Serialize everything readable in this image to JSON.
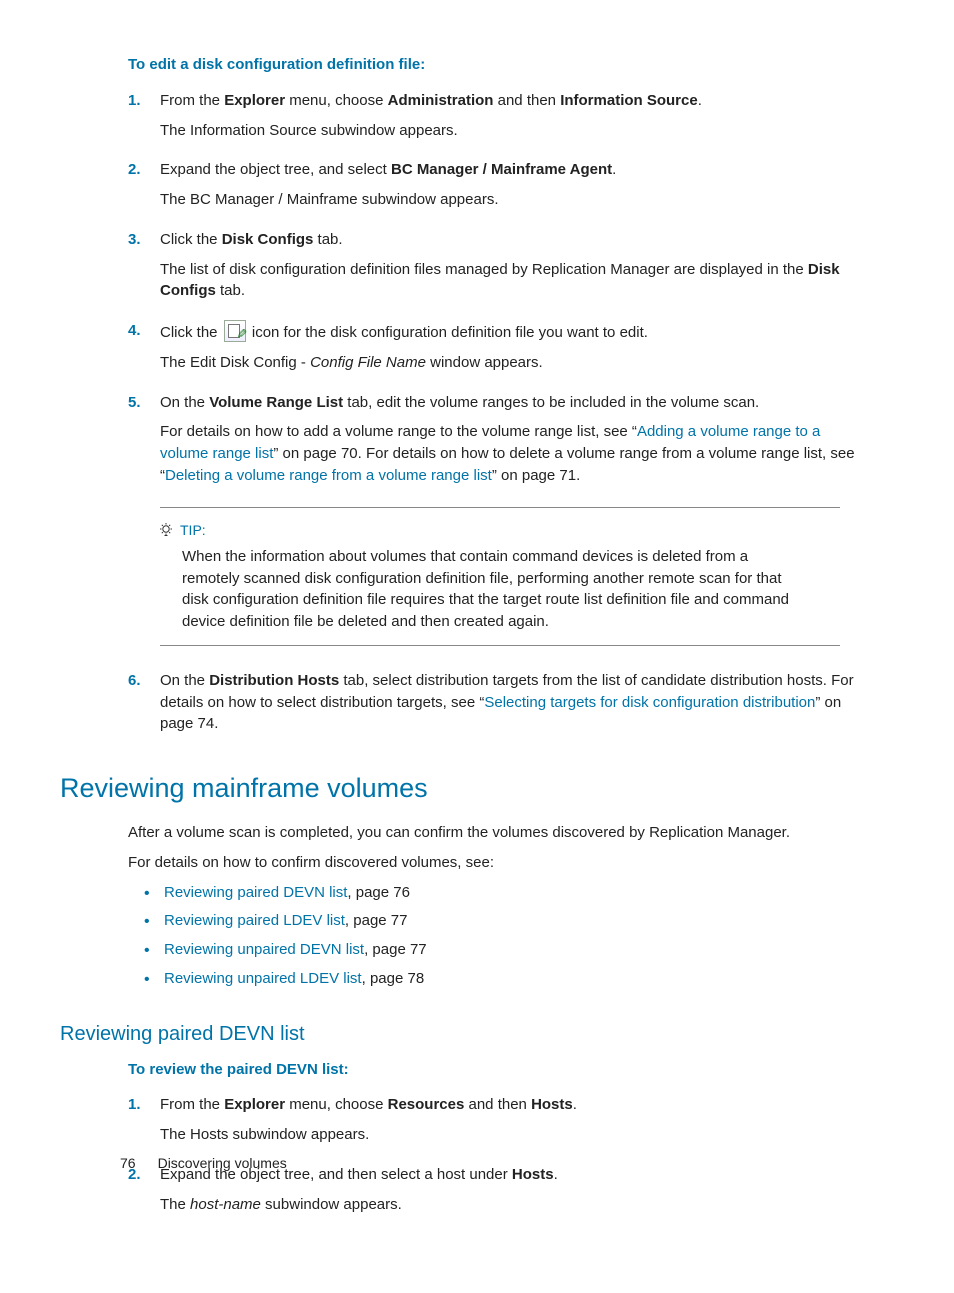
{
  "proc1": {
    "heading": "To edit a disk configuration definition file:",
    "steps": {
      "s1a": "From the ",
      "s1b": "Explorer",
      "s1c": " menu, choose ",
      "s1d": "Administration",
      "s1e": " and then ",
      "s1f": "Information Source",
      "s1g": ".",
      "s1_sub": "The Information Source subwindow appears.",
      "s2a": "Expand the object tree, and select ",
      "s2b": "BC Manager / Mainframe Agent",
      "s2c": ".",
      "s2_sub": "The BC Manager / Mainframe subwindow appears.",
      "s3a": "Click the ",
      "s3b": "Disk Configs",
      "s3c": " tab.",
      "s3_sub_a": "The list of disk configuration definition files managed by Replication Manager are displayed in the ",
      "s3_sub_b": "Disk Configs",
      "s3_sub_c": " tab.",
      "s4a": "Click the ",
      "s4b": " icon for the disk configuration definition file you want to edit.",
      "s4_sub_a": "The Edit Disk Config - ",
      "s4_sub_b": "Config File Name",
      "s4_sub_c": " window appears.",
      "s5a": "On the ",
      "s5b": "Volume Range List",
      "s5c": " tab, edit the volume ranges to be included in the volume scan.",
      "s5_sub_a": "For details on how to add a volume range to the volume range list, see “",
      "s5_link1": "Adding a volume range to a volume range list",
      "s5_sub_b": "” on page 70. For details on how to delete a volume range from a volume range list, see “",
      "s5_link2": "Deleting a volume range from a volume range list",
      "s5_sub_c": "” on page 71.",
      "s6a": "On the ",
      "s6b": "Distribution Hosts",
      "s6c": " tab, select distribution targets from the list of candidate distribution hosts. For details on how to select distribution targets, see “",
      "s6_link": "Selecting targets for disk configuration distribution",
      "s6d": "” on page 74."
    }
  },
  "tip": {
    "label": "TIP:",
    "body": "When the information about volumes that contain command devices is deleted from a remotely scanned disk configuration definition file, performing another remote scan for that disk configuration definition file requires that the target route list definition file and command device definition file be deleted and then created again."
  },
  "section2": {
    "title": "Reviewing mainframe volumes",
    "p1": "After a volume scan is completed, you can confirm the volumes discovered by Replication Manager.",
    "p2": "For details on how to confirm discovered volumes, see:",
    "bullets": {
      "b1_link": "Reviewing paired DEVN list",
      "b1_rest": ", page 76",
      "b2_link": "Reviewing paired LDEV list",
      "b2_rest": ", page 77",
      "b3_link": "Reviewing unpaired DEVN list",
      "b3_rest": ", page 77",
      "b4_link": "Reviewing unpaired LDEV list",
      "b4_rest": ", page 78"
    }
  },
  "subsection": {
    "title": "Reviewing paired DEVN list",
    "proc_heading": "To review the paired DEVN list:",
    "s1a": "From the ",
    "s1b": "Explorer",
    "s1c": " menu, choose ",
    "s1d": "Resources",
    "s1e": " and then ",
    "s1f": "Hosts",
    "s1g": ".",
    "s1_sub": "The Hosts subwindow appears.",
    "s2a": "Expand the object tree, and then select a host under ",
    "s2b": "Hosts",
    "s2c": ".",
    "s2_sub_a": "The ",
    "s2_sub_b": "host-name",
    "s2_sub_c": " subwindow appears."
  },
  "nums": {
    "n1": "1.",
    "n2": "2.",
    "n3": "3.",
    "n4": "4.",
    "n5": "5.",
    "n6": "6."
  },
  "footer": {
    "page": "76",
    "chapter": "Discovering volumes"
  }
}
